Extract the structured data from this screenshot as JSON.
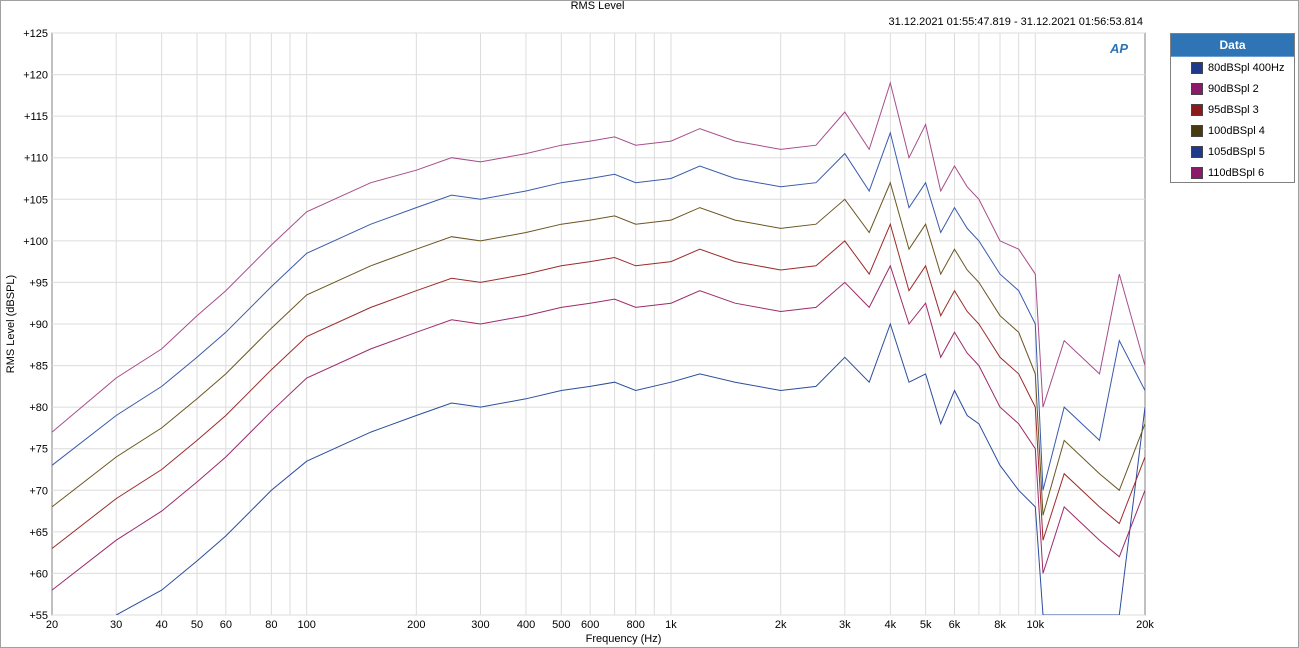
{
  "window": {
    "title": "RMS Level",
    "timestamp": "31.12.2021 01:55:47.819 - 31.12.2021 01:56:53.814",
    "logo": "AP"
  },
  "legend": {
    "header": "Data",
    "items": [
      {
        "label": "80dBSpl 400Hz",
        "color": "#1f3a8a"
      },
      {
        "label": "90dBSpl 2",
        "color": "#8b1a6b"
      },
      {
        "label": "95dBSpl 3",
        "color": "#8b1a1a"
      },
      {
        "label": "100dBSpl 4",
        "color": "#4a3a10"
      },
      {
        "label": "105dBSpl 5",
        "color": "#1f3a8a"
      },
      {
        "label": "110dBSpl 6",
        "color": "#8b1a6b"
      }
    ]
  },
  "chart_data": {
    "type": "line",
    "title": "RMS Level",
    "xlabel": "Frequency (Hz)",
    "ylabel": "RMS Level (dBSPL)",
    "xscale": "log",
    "xlim": [
      20,
      20000
    ],
    "ylim": [
      55,
      125
    ],
    "grid": true,
    "legend_position": "right",
    "x_ticks": [
      {
        "value": 20,
        "label": "20"
      },
      {
        "value": 30,
        "label": "30"
      },
      {
        "value": 40,
        "label": "40"
      },
      {
        "value": 50,
        "label": "50"
      },
      {
        "value": 60,
        "label": "60"
      },
      {
        "value": 80,
        "label": "80"
      },
      {
        "value": 100,
        "label": "100"
      },
      {
        "value": 200,
        "label": "200"
      },
      {
        "value": 300,
        "label": "300"
      },
      {
        "value": 400,
        "label": "400"
      },
      {
        "value": 500,
        "label": "500"
      },
      {
        "value": 600,
        "label": "600"
      },
      {
        "value": 800,
        "label": "800"
      },
      {
        "value": 1000,
        "label": "1k"
      },
      {
        "value": 2000,
        "label": "2k"
      },
      {
        "value": 3000,
        "label": "3k"
      },
      {
        "value": 4000,
        "label": "4k"
      },
      {
        "value": 5000,
        "label": "5k"
      },
      {
        "value": 6000,
        "label": "6k"
      },
      {
        "value": 8000,
        "label": "8k"
      },
      {
        "value": 10000,
        "label": "10k"
      },
      {
        "value": 20000,
        "label": "20k"
      }
    ],
    "y_ticks": [
      {
        "value": 125,
        "label": "+125"
      },
      {
        "value": 120,
        "label": "+120"
      },
      {
        "value": 115,
        "label": "+115"
      },
      {
        "value": 110,
        "label": "+110"
      },
      {
        "value": 105,
        "label": "+105"
      },
      {
        "value": 100,
        "label": "+100"
      },
      {
        "value": 95,
        "label": "+95"
      },
      {
        "value": 90,
        "label": "+90"
      },
      {
        "value": 85,
        "label": "+85"
      },
      {
        "value": 80,
        "label": "+80"
      },
      {
        "value": 75,
        "label": "+75"
      },
      {
        "value": 70,
        "label": "+70"
      },
      {
        "value": 65,
        "label": "+65"
      },
      {
        "value": 60,
        "label": "+60"
      },
      {
        "value": 55,
        "label": "+55"
      }
    ],
    "series": [
      {
        "name": "80dBSpl 400Hz",
        "color": "#2b4d9c",
        "points": [
          [
            30,
            55
          ],
          [
            40,
            58
          ],
          [
            50,
            61.5
          ],
          [
            60,
            64.5
          ],
          [
            80,
            70
          ],
          [
            100,
            73.5
          ],
          [
            150,
            77
          ],
          [
            200,
            79
          ],
          [
            250,
            80.5
          ],
          [
            300,
            80
          ],
          [
            400,
            81
          ],
          [
            500,
            82
          ],
          [
            600,
            82.5
          ],
          [
            700,
            83
          ],
          [
            800,
            82
          ],
          [
            1000,
            83
          ],
          [
            1200,
            84
          ],
          [
            1500,
            83
          ],
          [
            2000,
            82
          ],
          [
            2500,
            82.5
          ],
          [
            3000,
            86
          ],
          [
            3500,
            83
          ],
          [
            4000,
            90
          ],
          [
            4500,
            83
          ],
          [
            5000,
            84
          ],
          [
            5500,
            78
          ],
          [
            6000,
            82
          ],
          [
            6500,
            79
          ],
          [
            7000,
            78
          ],
          [
            8000,
            73
          ],
          [
            9000,
            70
          ],
          [
            10000,
            68
          ],
          [
            10500,
            55
          ],
          [
            12000,
            55
          ],
          [
            15000,
            55
          ],
          [
            17000,
            55
          ],
          [
            20000,
            80
          ]
        ]
      },
      {
        "name": "90dBSpl 2",
        "color": "#9c2b6b",
        "points": [
          [
            20,
            58
          ],
          [
            30,
            64
          ],
          [
            40,
            67.5
          ],
          [
            50,
            71
          ],
          [
            60,
            74
          ],
          [
            80,
            79.5
          ],
          [
            100,
            83.5
          ],
          [
            150,
            87
          ],
          [
            200,
            89
          ],
          [
            250,
            90.5
          ],
          [
            300,
            90
          ],
          [
            400,
            91
          ],
          [
            500,
            92
          ],
          [
            600,
            92.5
          ],
          [
            700,
            93
          ],
          [
            800,
            92
          ],
          [
            1000,
            92.5
          ],
          [
            1200,
            94
          ],
          [
            1500,
            92.5
          ],
          [
            2000,
            91.5
          ],
          [
            2500,
            92
          ],
          [
            3000,
            95
          ],
          [
            3500,
            92
          ],
          [
            4000,
            97
          ],
          [
            4500,
            90
          ],
          [
            5000,
            92.5
          ],
          [
            5500,
            86
          ],
          [
            6000,
            89
          ],
          [
            6500,
            86.5
          ],
          [
            7000,
            85
          ],
          [
            8000,
            80
          ],
          [
            9000,
            78
          ],
          [
            10000,
            75
          ],
          [
            10500,
            60
          ],
          [
            12000,
            68
          ],
          [
            15000,
            64
          ],
          [
            17000,
            62
          ],
          [
            20000,
            70
          ]
        ]
      },
      {
        "name": "95dBSpl 3",
        "color": "#9c2b2b",
        "points": [
          [
            20,
            63
          ],
          [
            30,
            69
          ],
          [
            40,
            72.5
          ],
          [
            50,
            76
          ],
          [
            60,
            79
          ],
          [
            80,
            84.5
          ],
          [
            100,
            88.5
          ],
          [
            150,
            92
          ],
          [
            200,
            94
          ],
          [
            250,
            95.5
          ],
          [
            300,
            95
          ],
          [
            400,
            96
          ],
          [
            500,
            97
          ],
          [
            600,
            97.5
          ],
          [
            700,
            98
          ],
          [
            800,
            97
          ],
          [
            1000,
            97.5
          ],
          [
            1200,
            99
          ],
          [
            1500,
            97.5
          ],
          [
            2000,
            96.5
          ],
          [
            2500,
            97
          ],
          [
            3000,
            100
          ],
          [
            3500,
            96
          ],
          [
            4000,
            102
          ],
          [
            4500,
            94
          ],
          [
            5000,
            97
          ],
          [
            5500,
            91
          ],
          [
            6000,
            94
          ],
          [
            6500,
            91.5
          ],
          [
            7000,
            90
          ],
          [
            8000,
            86
          ],
          [
            9000,
            84
          ],
          [
            10000,
            80
          ],
          [
            10500,
            64
          ],
          [
            12000,
            72
          ],
          [
            15000,
            68
          ],
          [
            17000,
            66
          ],
          [
            20000,
            74
          ]
        ]
      },
      {
        "name": "100dBSpl 4",
        "color": "#6b5520",
        "points": [
          [
            20,
            68
          ],
          [
            30,
            74
          ],
          [
            40,
            77.5
          ],
          [
            50,
            81
          ],
          [
            60,
            84
          ],
          [
            80,
            89.5
          ],
          [
            100,
            93.5
          ],
          [
            150,
            97
          ],
          [
            200,
            99
          ],
          [
            250,
            100.5
          ],
          [
            300,
            100
          ],
          [
            400,
            101
          ],
          [
            500,
            102
          ],
          [
            600,
            102.5
          ],
          [
            700,
            103
          ],
          [
            800,
            102
          ],
          [
            1000,
            102.5
          ],
          [
            1200,
            104
          ],
          [
            1500,
            102.5
          ],
          [
            2000,
            101.5
          ],
          [
            2500,
            102
          ],
          [
            3000,
            105
          ],
          [
            3500,
            101
          ],
          [
            4000,
            107
          ],
          [
            4500,
            99
          ],
          [
            5000,
            102
          ],
          [
            5500,
            96
          ],
          [
            6000,
            99
          ],
          [
            6500,
            96.5
          ],
          [
            7000,
            95
          ],
          [
            8000,
            91
          ],
          [
            9000,
            89
          ],
          [
            10000,
            84
          ],
          [
            10500,
            67
          ],
          [
            12000,
            76
          ],
          [
            15000,
            72
          ],
          [
            17000,
            70
          ],
          [
            20000,
            78
          ]
        ]
      },
      {
        "name": "105dBSpl 5",
        "color": "#3a5aab",
        "points": [
          [
            20,
            73
          ],
          [
            30,
            79
          ],
          [
            40,
            82.5
          ],
          [
            50,
            86
          ],
          [
            60,
            89
          ],
          [
            80,
            94.5
          ],
          [
            100,
            98.5
          ],
          [
            150,
            102
          ],
          [
            200,
            104
          ],
          [
            250,
            105.5
          ],
          [
            300,
            105
          ],
          [
            400,
            106
          ],
          [
            500,
            107
          ],
          [
            600,
            107.5
          ],
          [
            700,
            108
          ],
          [
            800,
            107
          ],
          [
            1000,
            107.5
          ],
          [
            1200,
            109
          ],
          [
            1500,
            107.5
          ],
          [
            2000,
            106.5
          ],
          [
            2500,
            107
          ],
          [
            3000,
            110.5
          ],
          [
            3500,
            106
          ],
          [
            4000,
            113
          ],
          [
            4500,
            104
          ],
          [
            5000,
            107
          ],
          [
            5500,
            101
          ],
          [
            6000,
            104
          ],
          [
            6500,
            101.5
          ],
          [
            7000,
            100
          ],
          [
            8000,
            96
          ],
          [
            9000,
            94
          ],
          [
            10000,
            90
          ],
          [
            10500,
            70
          ],
          [
            12000,
            80
          ],
          [
            15000,
            76
          ],
          [
            17000,
            88
          ],
          [
            20000,
            82
          ]
        ]
      },
      {
        "name": "110dBSpl 6",
        "color": "#a64d8a",
        "points": [
          [
            20,
            77
          ],
          [
            30,
            83.5
          ],
          [
            40,
            87
          ],
          [
            50,
            91
          ],
          [
            60,
            94
          ],
          [
            80,
            99.5
          ],
          [
            100,
            103.5
          ],
          [
            150,
            107
          ],
          [
            200,
            108.5
          ],
          [
            250,
            110
          ],
          [
            300,
            109.5
          ],
          [
            400,
            110.5
          ],
          [
            500,
            111.5
          ],
          [
            600,
            112
          ],
          [
            700,
            112.5
          ],
          [
            800,
            111.5
          ],
          [
            1000,
            112
          ],
          [
            1200,
            113.5
          ],
          [
            1500,
            112
          ],
          [
            2000,
            111
          ],
          [
            2500,
            111.5
          ],
          [
            3000,
            115.5
          ],
          [
            3500,
            111
          ],
          [
            4000,
            119
          ],
          [
            4500,
            110
          ],
          [
            5000,
            114
          ],
          [
            5500,
            106
          ],
          [
            6000,
            109
          ],
          [
            6500,
            106.5
          ],
          [
            7000,
            105
          ],
          [
            8000,
            100
          ],
          [
            9000,
            99
          ],
          [
            10000,
            96
          ],
          [
            10500,
            80
          ],
          [
            12000,
            88
          ],
          [
            15000,
            84
          ],
          [
            17000,
            96
          ],
          [
            20000,
            85
          ]
        ]
      }
    ]
  }
}
